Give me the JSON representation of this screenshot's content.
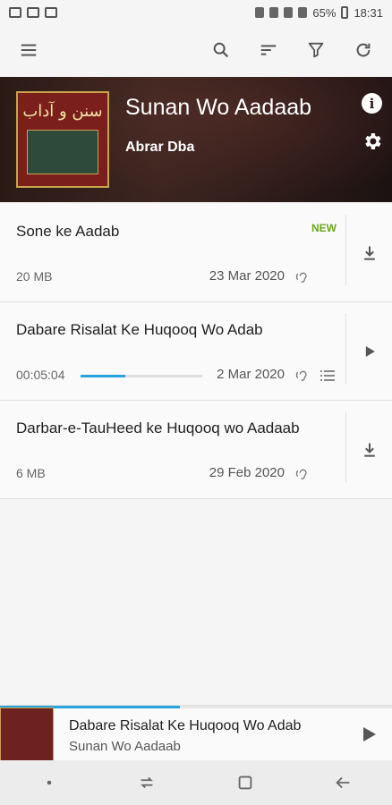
{
  "status_bar": {
    "battery": "65%",
    "time": "18:31",
    "network": "Vo) LTE"
  },
  "toolbar": {
    "icons": [
      "menu-icon",
      "search-icon",
      "sort-icon",
      "filter-icon",
      "refresh-icon"
    ]
  },
  "podcast": {
    "title": "Sunan Wo Aadaab",
    "author": "Abrar Dba",
    "cover_text": "سنن و آداب"
  },
  "episodes": [
    {
      "title": "Sone ke Aadab",
      "badge": "NEW",
      "size": "20 MB",
      "date": "23 Mar 2020",
      "action": "download"
    },
    {
      "title": "Dabare Risalat Ke Huqooq Wo Adab",
      "position": "00:05:04",
      "progress_fraction": 0.37,
      "date": "2 Mar 2020",
      "action": "play"
    },
    {
      "title": "Darbar-e-TauHeed ke Huqooq wo Aadaab",
      "size": "6 MB",
      "date": "29 Feb 2020",
      "action": "download"
    }
  ],
  "mini_player": {
    "title": "Dabare Risalat Ke Huqooq Wo Adab",
    "podcast": "Sunan Wo Aadaab",
    "progress_fraction": 0.46
  },
  "colors": {
    "accent": "#29a3dc",
    "new_badge": "#6aa720"
  }
}
